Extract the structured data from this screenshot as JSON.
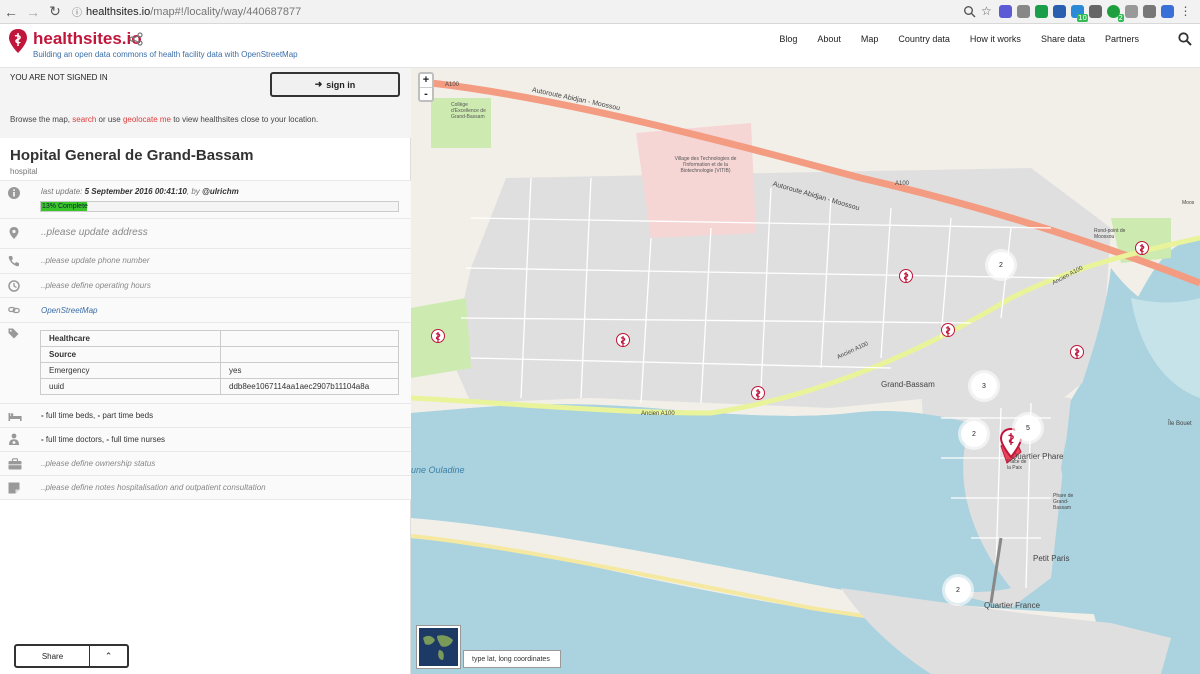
{
  "browser": {
    "url_host": "healthsites.io",
    "url_path": "/map#!/locality/way/440687877",
    "ext_badges": [
      "10",
      "2"
    ]
  },
  "header": {
    "logo_text": "healthsites.io",
    "tagline": "Building an open data commons of health facility data with OpenStreetMap",
    "nav": [
      "Blog",
      "About",
      "Map",
      "Country data",
      "How it works",
      "Share data",
      "Partners"
    ]
  },
  "sidebar": {
    "not_signed": "YOU ARE NOT SIGNED IN",
    "signin_label": "sign in",
    "browse": {
      "before": "Browse the map, ",
      "search": "search",
      "middle": " or use ",
      "geolocate": "geolocate me",
      "after": " to view healthsites close to your location."
    },
    "facility": {
      "title": "Hopital General de Grand-Bassam",
      "type": "hospital",
      "last_update_prefix": "last update: ",
      "last_update_date": "5 September 2016 00:41:10",
      "by": ", by ",
      "user": "@ulrichm",
      "completeness_label": "13% Complete",
      "completeness": 13,
      "address": "..please update address",
      "phone": "..please update phone number",
      "hours": "..please define operating hours",
      "osm_link": "OpenStreetMap",
      "attributes": [
        {
          "k": "Healthcare",
          "v": "",
          "bold": true
        },
        {
          "k": "Source",
          "v": "",
          "bold": true
        },
        {
          "k": "Emergency",
          "v": "yes",
          "bold": false
        },
        {
          "k": "uuid",
          "v": "ddb8ee1067114aa1aec2907b11104a8a",
          "bold": false
        }
      ],
      "beds": {
        "dash1": "-",
        "full": " full time beds, ",
        "dash2": "-",
        "part": " part time beds"
      },
      "staff": {
        "dash1": "-",
        "doctors": " full time doctors, ",
        "dash2": "-",
        "nurses": " full time nurses"
      },
      "ownership": "..please define ownership status",
      "notes": "..please define notes hospitalisation and outpatient consultation"
    },
    "share_label": "Share",
    "share_caret": "⌃"
  },
  "map": {
    "zoom_in": "+",
    "zoom_out": "-",
    "coord_placeholder": "type lat, long coordinates",
    "labels": {
      "autoroute1": "Autoroute Abidjan - Moossou",
      "autoroute2": "Autoroute Abidjan - Moossou",
      "a100_1": "A100",
      "a100_2": "A100",
      "college": "Collège d'Excellence de Grand-Bassam",
      "village": "Village des Technologies de l'Information et de la Biotechnologie (VITIB)",
      "rond_point": "Rond-point de Moossou",
      "ancien1": "Ancien A100",
      "ancien2": "Ancien A100",
      "ancien3": "Ancien A100",
      "grand_bassam": "Grand-Bassam",
      "quartier_phare": "Quartier Phare",
      "place_paix": "Place de la Paix",
      "phare": "Phare de Grand-Bassam",
      "ile_bouet": "Île Bouet",
      "petit_paris": "Petit Paris",
      "quartier_france": "Quartier France",
      "lagune": "une Ouladine",
      "moossou": "Moos"
    },
    "clusters": [
      "2",
      "3",
      "2",
      "5",
      "2"
    ]
  }
}
